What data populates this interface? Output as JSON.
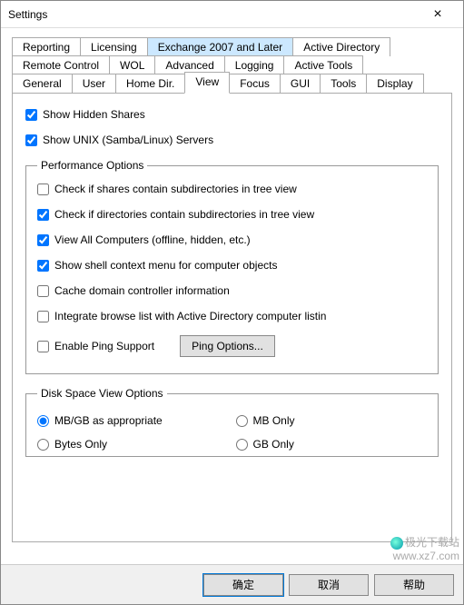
{
  "window": {
    "title": "Settings"
  },
  "tabs": {
    "row1": [
      "Reporting",
      "Licensing",
      "Exchange 2007 and Later",
      "Active Directory"
    ],
    "row2": [
      "Remote Control",
      "WOL",
      "Advanced",
      "Logging",
      "Active Tools"
    ],
    "row3": [
      "General",
      "User",
      "Home Dir.",
      "View",
      "Focus",
      "GUI",
      "Tools",
      "Display"
    ],
    "highlighted": "Exchange 2007 and Later",
    "active": "View"
  },
  "view": {
    "show_hidden_shares": {
      "label": "Show Hidden Shares",
      "checked": true
    },
    "show_unix_servers": {
      "label": "Show UNIX (Samba/Linux) Servers",
      "checked": true
    },
    "perf_group_label": "Performance Options",
    "perf": {
      "check_shares_subdirs": {
        "label": "Check if shares contain subdirectories in tree view",
        "checked": false
      },
      "check_dirs_subdirs": {
        "label": "Check if directories contain subdirectories in tree view",
        "checked": true
      },
      "view_all_computers": {
        "label": "View All Computers (offline, hidden, etc.)",
        "checked": true
      },
      "show_shell_context": {
        "label": "Show shell context menu for computer objects",
        "checked": true
      },
      "cache_domain_controller": {
        "label": "Cache domain controller information",
        "checked": false
      },
      "integrate_browse_list": {
        "label": "Integrate browse list with Active Directory computer listin",
        "checked": false
      },
      "enable_ping": {
        "label": "Enable Ping Support",
        "checked": false
      },
      "ping_button": "Ping Options..."
    },
    "disk_group_label": "Disk Space View Options",
    "disk": {
      "options": [
        "MB/GB as appropriate",
        "MB Only",
        "Bytes Only",
        "GB Only"
      ],
      "selected": "MB/GB as appropriate"
    }
  },
  "buttons": {
    "ok": "确定",
    "cancel": "取消",
    "help": "帮助"
  },
  "watermark": {
    "line1": "极光下载站",
    "line2": "www.xz7.com"
  }
}
